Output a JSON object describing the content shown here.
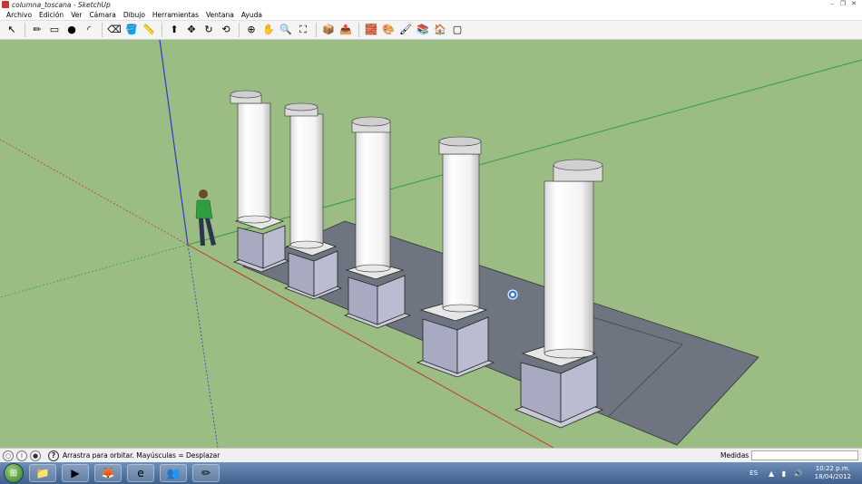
{
  "window": {
    "title": "columna_toscana - SketchUp"
  },
  "menu": [
    "Archivo",
    "Edición",
    "Ver",
    "Cámara",
    "Dibujo",
    "Herramientas",
    "Ventana",
    "Ayuda"
  ],
  "toolbar": {
    "groups": [
      [
        {
          "name": "select-tool",
          "glyph": "↖"
        }
      ],
      [
        {
          "name": "line-tool",
          "glyph": "✏"
        },
        {
          "name": "rectangle-tool",
          "glyph": "▭"
        },
        {
          "name": "circle-tool",
          "glyph": "●"
        },
        {
          "name": "arc-tool",
          "glyph": "◜"
        }
      ],
      [
        {
          "name": "eraser-tool",
          "glyph": "⌫"
        },
        {
          "name": "paint-bucket-tool",
          "glyph": "🪣"
        },
        {
          "name": "tape-measure-tool",
          "glyph": "📏"
        }
      ],
      [
        {
          "name": "push-pull-tool",
          "glyph": "⬆"
        },
        {
          "name": "move-tool",
          "glyph": "✥"
        },
        {
          "name": "rotate-tool",
          "glyph": "↻"
        },
        {
          "name": "follow-me-tool",
          "glyph": "⟲"
        }
      ],
      [
        {
          "name": "orbit-tool",
          "glyph": "⊕"
        },
        {
          "name": "pan-tool",
          "glyph": "✋"
        },
        {
          "name": "zoom-tool",
          "glyph": "🔍"
        },
        {
          "name": "zoom-extents-tool",
          "glyph": "⛶"
        }
      ],
      [
        {
          "name": "get-models-tool",
          "glyph": "📦"
        },
        {
          "name": "share-model-tool",
          "glyph": "📤"
        }
      ],
      [
        {
          "name": "components-tool",
          "glyph": "🧱"
        },
        {
          "name": "materials-tool",
          "glyph": "🎨"
        },
        {
          "name": "styles-tool",
          "glyph": "🖌"
        },
        {
          "name": "layers-tool",
          "glyph": "📚"
        },
        {
          "name": "scenes-tool",
          "glyph": "🏠"
        },
        {
          "name": "fog-tool",
          "glyph": "▢"
        }
      ]
    ]
  },
  "status": {
    "hint": "Arrastra para orbitar. Mayúsculas = Desplazar",
    "measure_label": "Medidas",
    "help_glyph": "?"
  },
  "taskbar": {
    "apps": [
      {
        "name": "explorer-taskbar-icon",
        "glyph": "📁"
      },
      {
        "name": "media-player-taskbar-icon",
        "glyph": "▶"
      },
      {
        "name": "firefox-taskbar-icon",
        "glyph": "🦊"
      },
      {
        "name": "internet-explorer-taskbar-icon",
        "glyph": "e"
      },
      {
        "name": "messenger-taskbar-icon",
        "glyph": "👥"
      },
      {
        "name": "sketchup-taskbar-icon",
        "glyph": "✏"
      }
    ],
    "language": "ES",
    "time": "10:22 p.m.",
    "date": "18/04/2012"
  },
  "scene_colors": {
    "ground": "#9bbc82",
    "floor_slab": "#6f7580",
    "pedestal": "#aeb1c7",
    "column": "#ffffff",
    "axis_red": "#c0392b",
    "axis_green": "#2ea043",
    "axis_blue": "#2a3bd1"
  }
}
